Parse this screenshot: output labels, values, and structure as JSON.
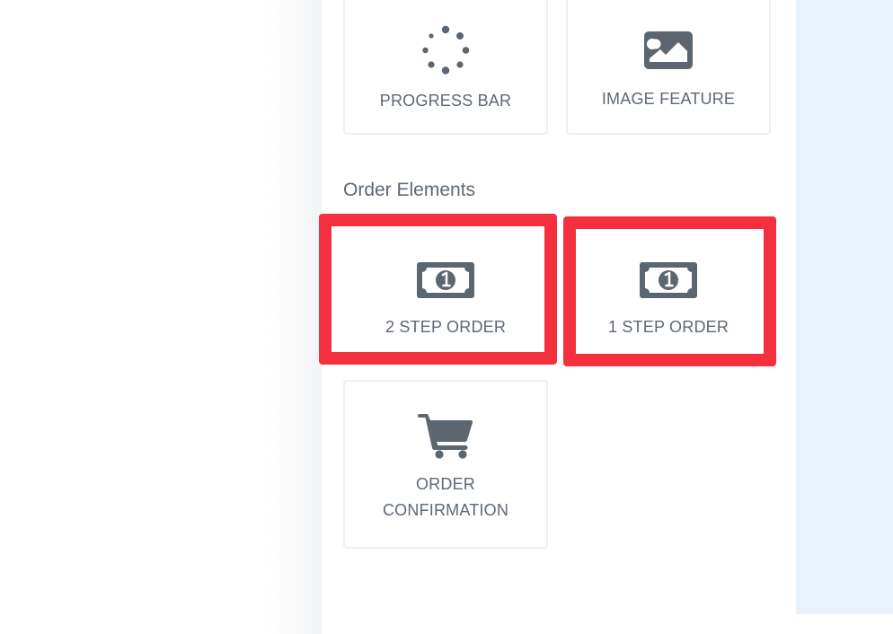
{
  "top_tiles": [
    {
      "label": "PROGRESS BAR",
      "icon": "spinner-icon"
    },
    {
      "label": "IMAGE FEATURE",
      "icon": "image-icon"
    }
  ],
  "order_section": {
    "title": "Order Elements",
    "tiles": [
      {
        "label": "2 STEP ORDER",
        "icon": "money-bill-icon"
      },
      {
        "label": "1 STEP ORDER",
        "icon": "money-bill-icon"
      },
      {
        "label_line1": "ORDER",
        "label_line2": "CONFIRMATION",
        "icon": "shopping-cart-icon"
      }
    ]
  },
  "colors": {
    "highlight": "#f4303f",
    "text": "#5e6874",
    "icon": "#5c6670",
    "canvas_background": "#e7f2fd"
  }
}
